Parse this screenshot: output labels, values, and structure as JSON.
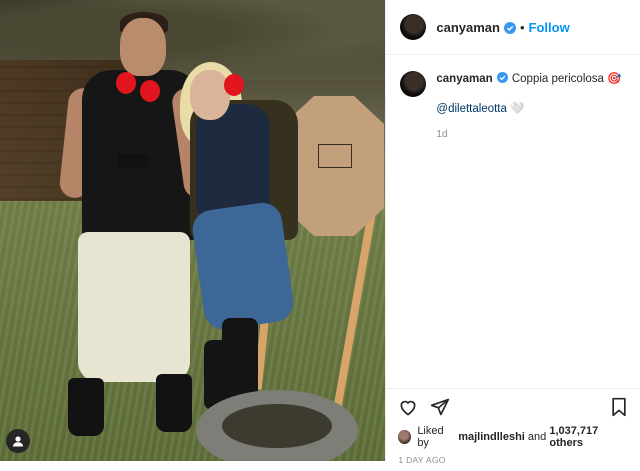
{
  "post": {
    "username": "canyaman",
    "follow_label": "Follow",
    "separator": "•",
    "caption": "Coppia pericolosa 🎯",
    "mention": "@dilettaleotta 🤍",
    "relative_time": "1d",
    "liked_by_prefix": "Liked by",
    "liked_by_user": "majlindlleshi",
    "liked_by_and": "and",
    "likes_others": "1,037,717 others",
    "date": "1 DAY AGO"
  },
  "icons": {
    "verified": "verified-badge-icon",
    "like": "heart-icon",
    "share": "paper-plane-icon",
    "save": "bookmark-icon",
    "tag": "user-tag-icon"
  },
  "colors": {
    "accent": "#0095f6",
    "verified": "#3897f0",
    "mention": "#00376b",
    "muted": "#8e8e8e"
  }
}
